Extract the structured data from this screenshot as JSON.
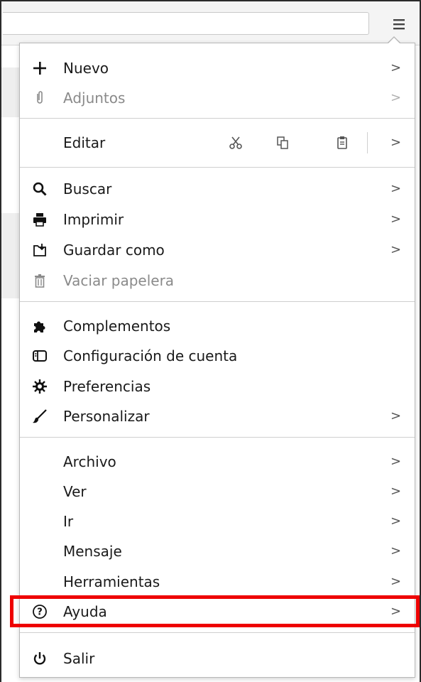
{
  "menu": {
    "items": [
      {
        "label": "Nuevo",
        "icon": "plus-icon",
        "submenu": true,
        "enabled": true
      },
      {
        "label": "Adjuntos",
        "icon": "paperclip-icon",
        "submenu": true,
        "enabled": false
      },
      {
        "label": "Editar",
        "submenu": true,
        "enabled": true,
        "tools": [
          "scissors-icon",
          "copy-icon",
          "paste-icon"
        ]
      },
      {
        "label": "Buscar",
        "icon": "search-icon",
        "submenu": true,
        "enabled": true
      },
      {
        "label": "Imprimir",
        "icon": "printer-icon",
        "submenu": true,
        "enabled": true
      },
      {
        "label": "Guardar como",
        "icon": "save-as-icon",
        "submenu": true,
        "enabled": true
      },
      {
        "label": "Vaciar papelera",
        "icon": "trash-icon",
        "submenu": false,
        "enabled": false
      },
      {
        "label": "Complementos",
        "icon": "puzzle-icon",
        "submenu": false,
        "enabled": true
      },
      {
        "label": "Configuración de cuenta",
        "icon": "account-settings-icon",
        "submenu": false,
        "enabled": true
      },
      {
        "label": "Preferencias",
        "icon": "gear-icon",
        "submenu": false,
        "enabled": true
      },
      {
        "label": "Personalizar",
        "icon": "brush-icon",
        "submenu": true,
        "enabled": true
      },
      {
        "label": "Archivo",
        "submenu": true,
        "enabled": true
      },
      {
        "label": "Ver",
        "submenu": true,
        "enabled": true
      },
      {
        "label": "Ir",
        "submenu": true,
        "enabled": true
      },
      {
        "label": "Mensaje",
        "submenu": true,
        "enabled": true
      },
      {
        "label": "Herramientas",
        "submenu": true,
        "enabled": true
      },
      {
        "label": "Ayuda",
        "icon": "help-icon",
        "submenu": true,
        "enabled": true,
        "highlighted": true
      },
      {
        "label": "Salir",
        "icon": "power-icon",
        "submenu": false,
        "enabled": true
      }
    ],
    "chevron": ">"
  },
  "toolbar": {
    "menu_button_icon": "hamburger-menu-icon"
  },
  "colors": {
    "highlight": "#ee0000",
    "disabled_text": "#8a8a8a"
  }
}
